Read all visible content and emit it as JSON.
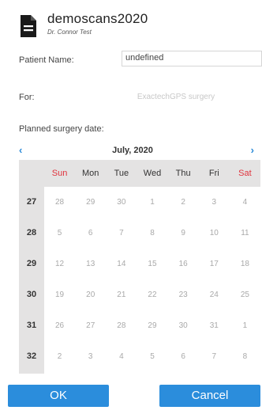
{
  "header": {
    "title": "demoscans2020",
    "subtitle": "Dr. Connor Test",
    "icon": "document-icon"
  },
  "form": {
    "patient_name_label": "Patient Name:",
    "patient_name_value": "undefined",
    "for_label": "For:",
    "for_value": "ExactechGPS surgery",
    "date_label": "Planned surgery date:"
  },
  "calendar": {
    "prev_glyph": "‹",
    "next_glyph": "›",
    "month_title": "July, 2020",
    "weekdays": [
      "Sun",
      "Mon",
      "Tue",
      "Wed",
      "Thu",
      "Fri",
      "Sat"
    ],
    "weekend_color": "#e0333d",
    "weeks": [
      {
        "num": "27",
        "days": [
          "28",
          "29",
          "30",
          "1",
          "2",
          "3",
          "4"
        ]
      },
      {
        "num": "28",
        "days": [
          "5",
          "6",
          "7",
          "8",
          "9",
          "10",
          "11"
        ]
      },
      {
        "num": "29",
        "days": [
          "12",
          "13",
          "14",
          "15",
          "16",
          "17",
          "18"
        ]
      },
      {
        "num": "30",
        "days": [
          "19",
          "20",
          "21",
          "22",
          "23",
          "24",
          "25"
        ]
      },
      {
        "num": "31",
        "days": [
          "26",
          "27",
          "28",
          "29",
          "30",
          "31",
          "1"
        ]
      },
      {
        "num": "32",
        "days": [
          "2",
          "3",
          "4",
          "5",
          "6",
          "7",
          "8"
        ]
      }
    ]
  },
  "buttons": {
    "ok_label": "OK",
    "cancel_label": "Cancel",
    "accent": "#2b8ddc"
  }
}
